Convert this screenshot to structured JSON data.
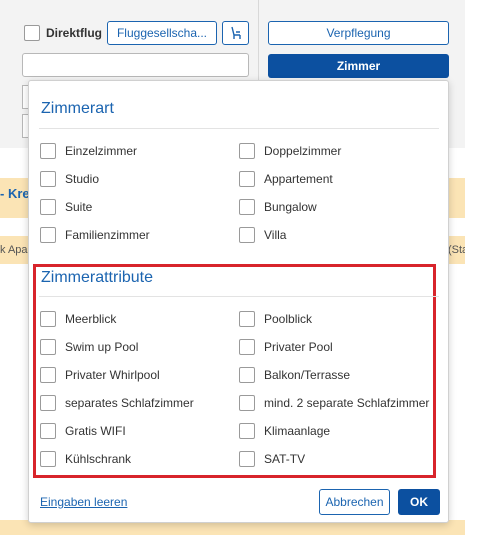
{
  "background": {
    "direktflug_label": "Direktflug",
    "airline_button": "Fluggesellscha...",
    "meal_button": "Verpflegung",
    "room_button": "Zimmer",
    "stripe_text": "- Kre",
    "apar_text": "k Apar",
    "sta_text": "(Sta"
  },
  "popup": {
    "room_type": {
      "title": "Zimmerart",
      "left": [
        "Einzelzimmer",
        "Studio",
        "Suite",
        "Familienzimmer"
      ],
      "right": [
        "Doppelzimmer",
        "Appartement",
        "Bungalow",
        "Villa"
      ]
    },
    "room_attributes": {
      "title": "Zimmerattribute",
      "left": [
        "Meerblick",
        "Swim up Pool",
        "Privater Whirlpool",
        "separates Schlafzimmer",
        "Gratis WIFI",
        "Kühlschrank"
      ],
      "right": [
        "Poolblick",
        "Privater Pool",
        "Balkon/Terrasse",
        "mind. 2 separate Schlafzimmer",
        "Klimaanlage",
        "SAT-TV"
      ]
    },
    "clear_link": "Eingaben leeren",
    "cancel_button": "Abbrechen",
    "ok_button": "OK"
  },
  "colors": {
    "accent": "#0c50a0",
    "link": "#1b64b0",
    "highlight": "#d8242b",
    "stripe": "#fbe4b5"
  }
}
